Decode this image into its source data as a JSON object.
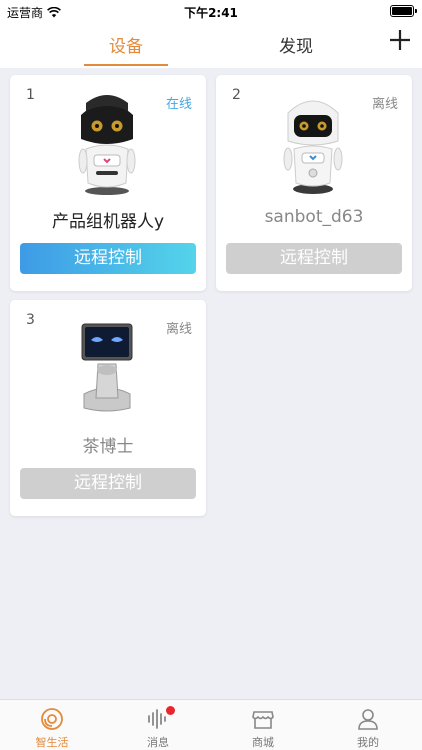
{
  "status_bar": {
    "carrier": "运营商",
    "time": "下午2:41"
  },
  "top_nav": {
    "tabs": [
      {
        "label": "设备"
      },
      {
        "label": "发现"
      }
    ],
    "add_icon": "plus-icon"
  },
  "devices": [
    {
      "index": "1",
      "status": "在线",
      "name": "产品组机器人y",
      "control_label": "远程控制",
      "online": true
    },
    {
      "index": "2",
      "status": "离线",
      "name": "sanbot_d63",
      "control_label": "远程控制",
      "online": false
    },
    {
      "index": "3",
      "status": "离线",
      "name": "茶博士",
      "control_label": "远程控制",
      "online": false
    }
  ],
  "bottom_nav": {
    "items": [
      {
        "label": "智生活",
        "icon": "smart-life-icon"
      },
      {
        "label": "消息",
        "icon": "voice-wave-icon"
      },
      {
        "label": "商城",
        "icon": "store-icon"
      },
      {
        "label": "我的",
        "icon": "profile-icon"
      }
    ]
  },
  "colors": {
    "accent": "#e38a3b",
    "online": "#46a9e0",
    "badge": "#e8262d"
  }
}
